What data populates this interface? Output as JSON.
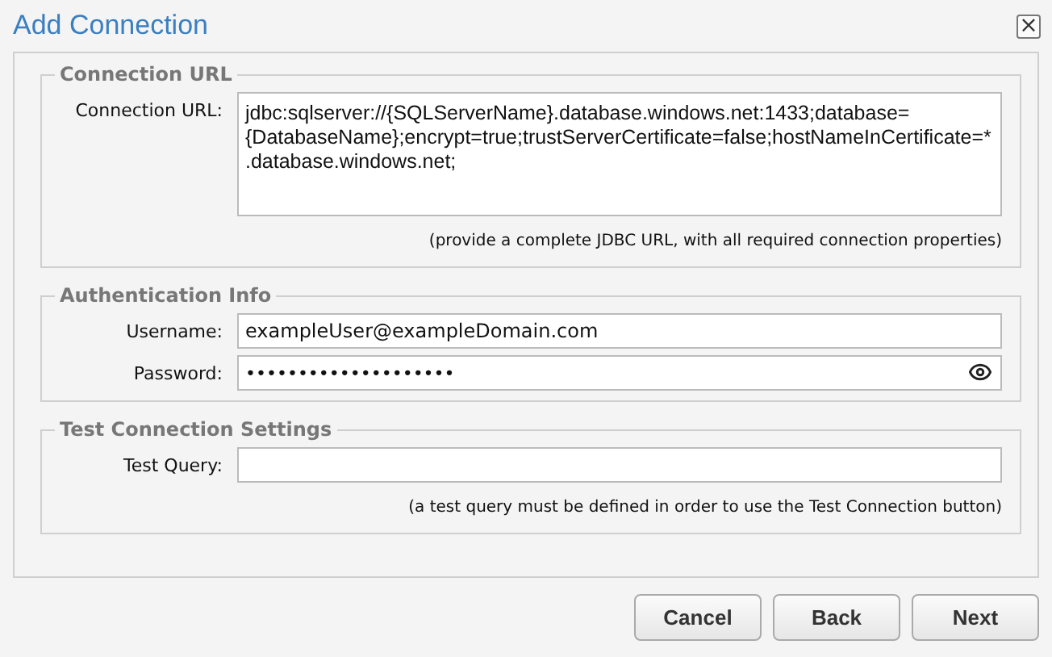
{
  "window": {
    "title": "Add Connection",
    "close": "×"
  },
  "sections": [
    {
      "legend": "Connection URL",
      "fields": [
        {
          "kind": "textarea",
          "label": "Connection URL:",
          "value": "jdbc:sqlserver://{SQLServerName}.database.windows.net:1433;database={DatabaseName};encrypt=true;trustServerCertificate=false;hostNameInCertificate=*.database.windows.net;"
        }
      ],
      "hint": "(provide a complete JDBC URL, with all required connection properties)"
    },
    {
      "legend": "Authentication Info",
      "fields": [
        {
          "kind": "text",
          "label": "Username:",
          "value": "exampleUser@exampleDomain.com"
        },
        {
          "kind": "password",
          "label": "Password:",
          "value": "••••••••••••••••••••"
        }
      ]
    },
    {
      "legend": "Test Connection Settings",
      "fields": [
        {
          "kind": "text",
          "label": "Test Query:"
        }
      ],
      "hint": "(a test query must be defined in order to use the Test Connection button)"
    }
  ],
  "buttons": [
    "Cancel",
    "Back",
    "Next"
  ]
}
